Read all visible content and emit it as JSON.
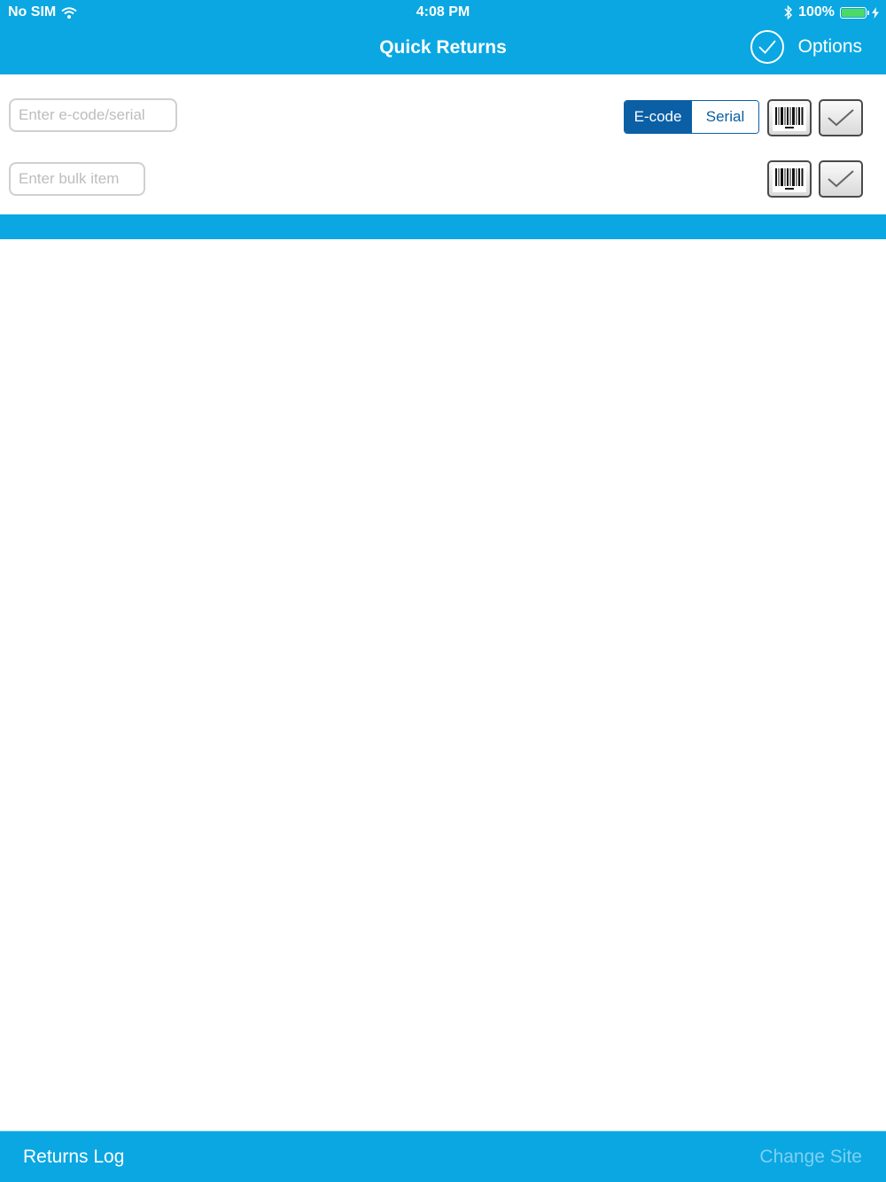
{
  "status_bar": {
    "carrier": "No SIM",
    "time": "4:08 PM",
    "battery": "100%"
  },
  "nav": {
    "title": "Quick Returns",
    "options_label": "Options"
  },
  "form": {
    "ecode_placeholder": "Enter e-code/serial",
    "bulk_placeholder": "Enter bulk item",
    "segment": {
      "options": [
        "E-code",
        "Serial"
      ],
      "selected": "E-code"
    }
  },
  "bottom_bar": {
    "left_label": "Returns Log",
    "right_label": "Change Site"
  },
  "colors": {
    "primary": "#0aa7e2",
    "segment_active": "#0b5fa5",
    "disabled_text": "#7fd0f2"
  },
  "icons": [
    "wifi-icon",
    "bluetooth-icon",
    "battery-icon",
    "charging-icon",
    "check-circle-icon",
    "barcode-icon",
    "checkmark-icon"
  ]
}
